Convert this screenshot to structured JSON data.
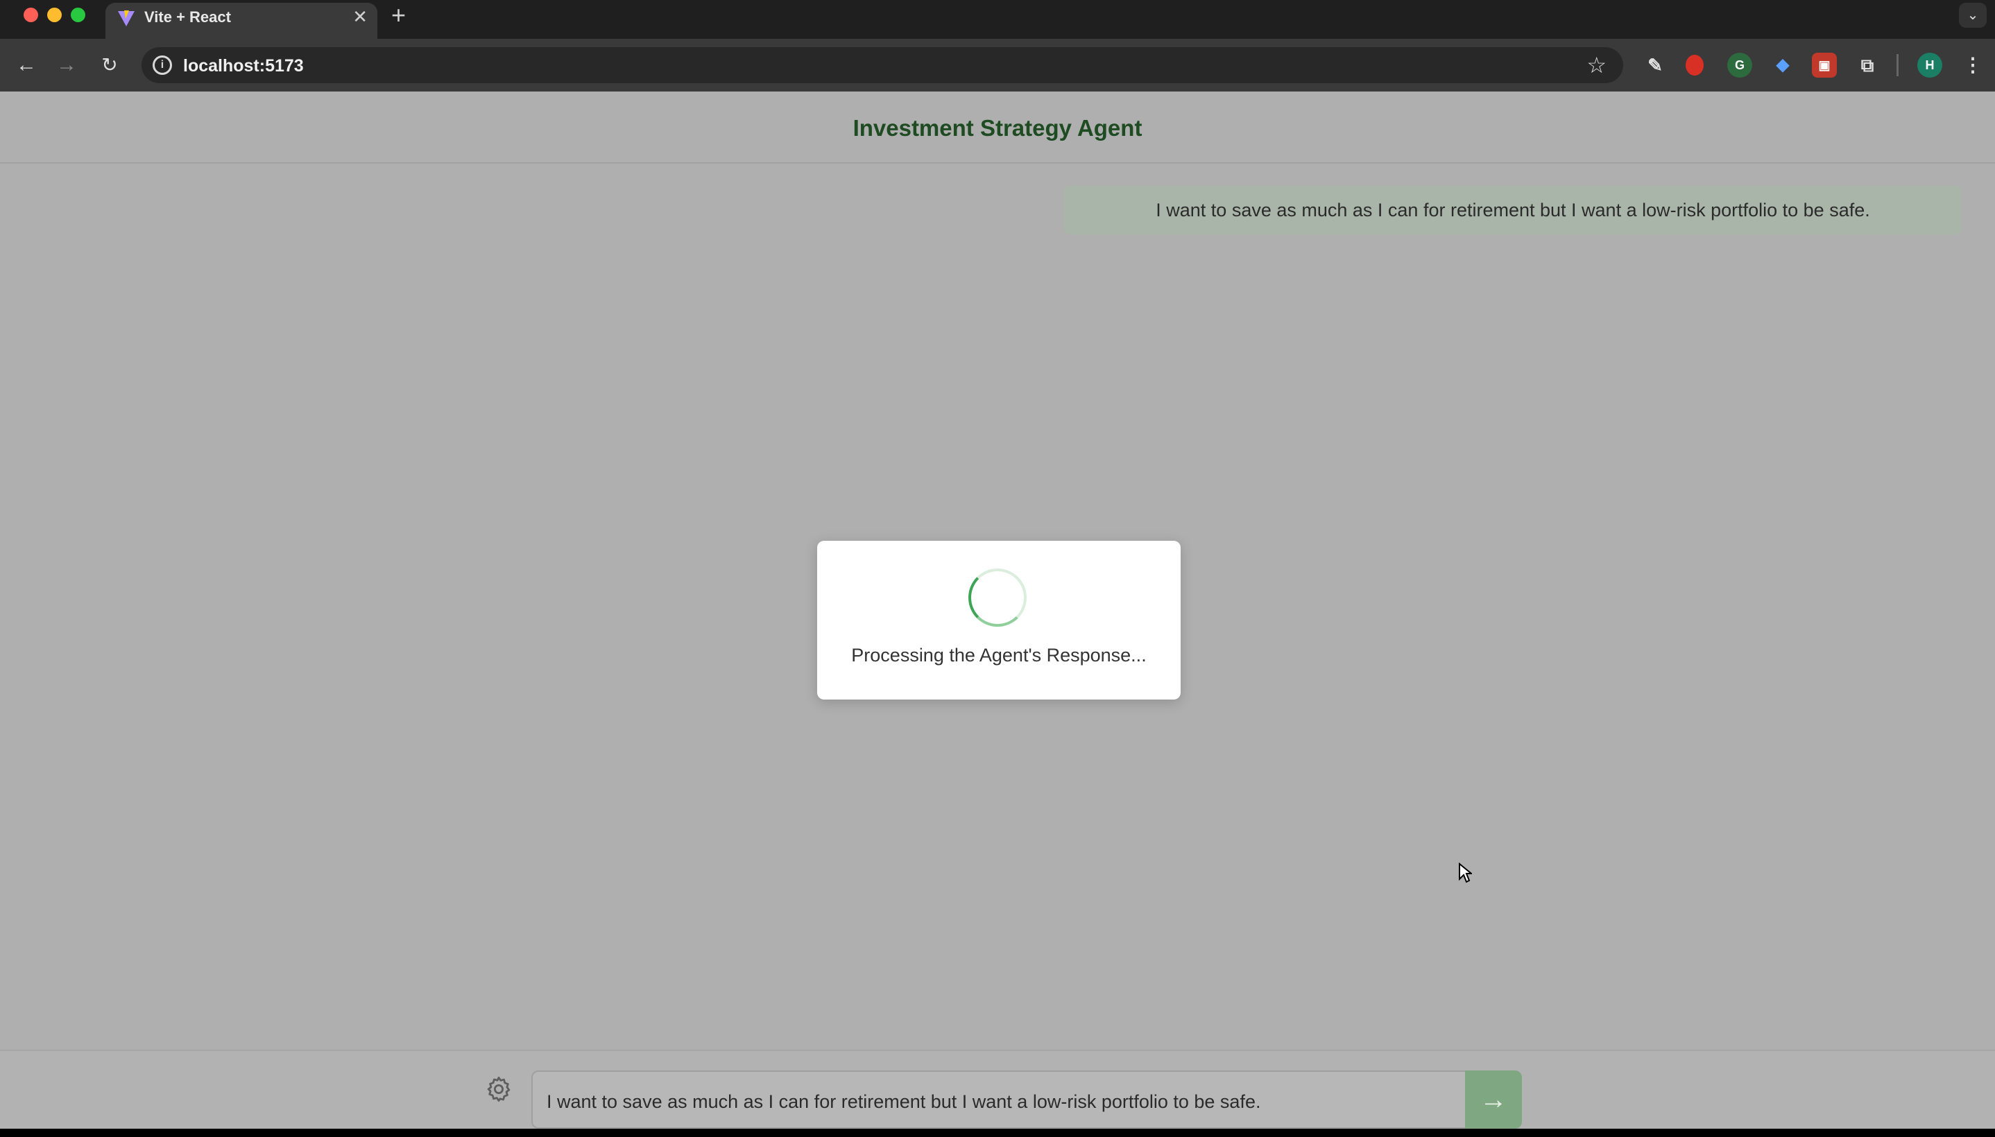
{
  "browser": {
    "tab_title": "Vite + React",
    "new_tab_glyph": "+",
    "close_glyph": "✕",
    "url": "localhost:5173",
    "profile_initial": "H"
  },
  "app": {
    "title": "Investment Strategy Agent",
    "user_message": "I want to save as much as I can for retirement but I want a low-risk portfolio to be safe.",
    "processing_text": "Processing the Agent's Response...",
    "input_value": "I want to save as much as I can for retirement but I want a low-risk portfolio to be safe.",
    "send_glyph": "→",
    "settings_icon": "gear-icon"
  },
  "colors": {
    "title_green": "#1e4b22",
    "send_button": "#7fa882",
    "spinner_green": "#3fa556"
  }
}
